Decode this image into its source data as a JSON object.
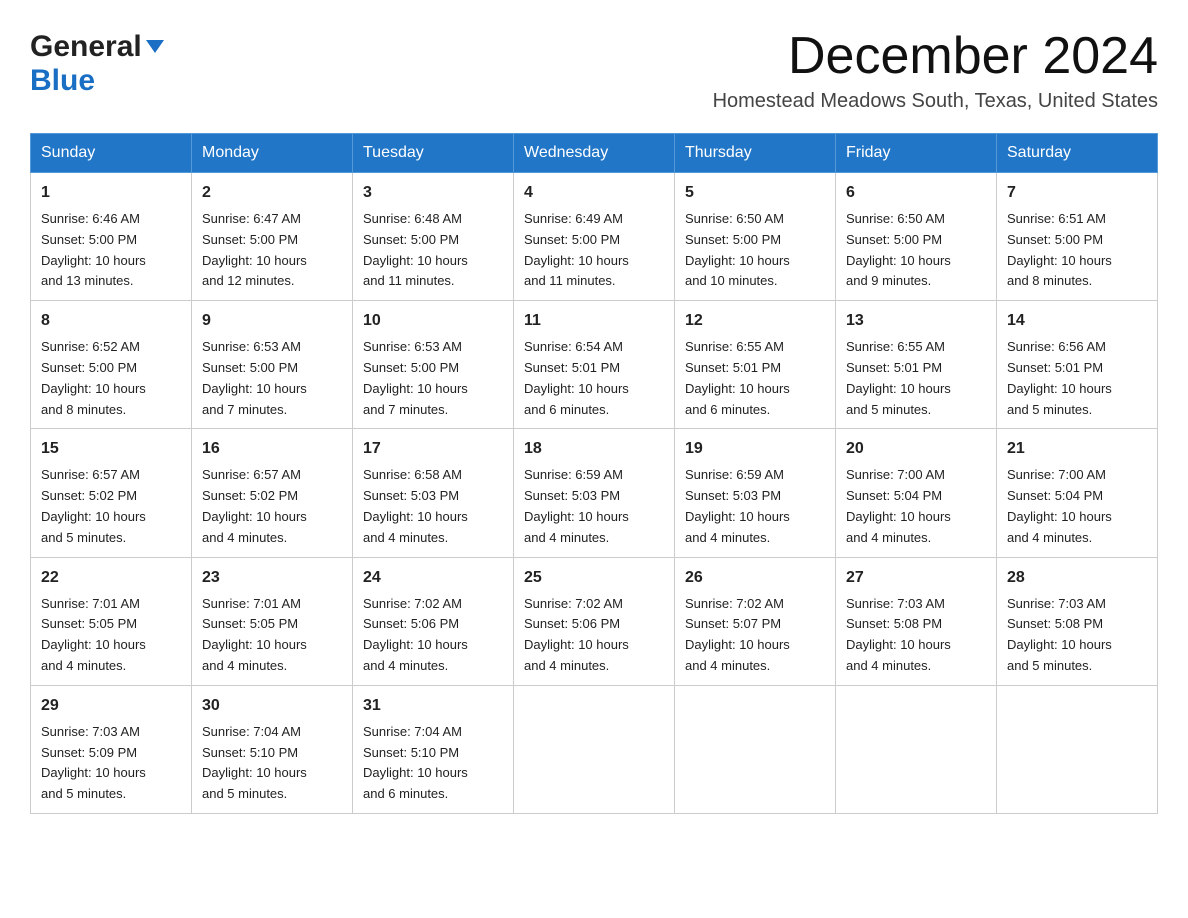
{
  "header": {
    "logo": {
      "general": "General",
      "arrow": "▼",
      "blue": "Blue"
    },
    "title": "December 2024",
    "location": "Homestead Meadows South, Texas, United States"
  },
  "weekdays": [
    "Sunday",
    "Monday",
    "Tuesday",
    "Wednesday",
    "Thursday",
    "Friday",
    "Saturday"
  ],
  "weeks": [
    [
      {
        "day": "1",
        "sunrise": "6:46 AM",
        "sunset": "5:00 PM",
        "daylight": "10 hours and 13 minutes."
      },
      {
        "day": "2",
        "sunrise": "6:47 AM",
        "sunset": "5:00 PM",
        "daylight": "10 hours and 12 minutes."
      },
      {
        "day": "3",
        "sunrise": "6:48 AM",
        "sunset": "5:00 PM",
        "daylight": "10 hours and 11 minutes."
      },
      {
        "day": "4",
        "sunrise": "6:49 AM",
        "sunset": "5:00 PM",
        "daylight": "10 hours and 11 minutes."
      },
      {
        "day": "5",
        "sunrise": "6:50 AM",
        "sunset": "5:00 PM",
        "daylight": "10 hours and 10 minutes."
      },
      {
        "day": "6",
        "sunrise": "6:50 AM",
        "sunset": "5:00 PM",
        "daylight": "10 hours and 9 minutes."
      },
      {
        "day": "7",
        "sunrise": "6:51 AM",
        "sunset": "5:00 PM",
        "daylight": "10 hours and 8 minutes."
      }
    ],
    [
      {
        "day": "8",
        "sunrise": "6:52 AM",
        "sunset": "5:00 PM",
        "daylight": "10 hours and 8 minutes."
      },
      {
        "day": "9",
        "sunrise": "6:53 AM",
        "sunset": "5:00 PM",
        "daylight": "10 hours and 7 minutes."
      },
      {
        "day": "10",
        "sunrise": "6:53 AM",
        "sunset": "5:00 PM",
        "daylight": "10 hours and 7 minutes."
      },
      {
        "day": "11",
        "sunrise": "6:54 AM",
        "sunset": "5:01 PM",
        "daylight": "10 hours and 6 minutes."
      },
      {
        "day": "12",
        "sunrise": "6:55 AM",
        "sunset": "5:01 PM",
        "daylight": "10 hours and 6 minutes."
      },
      {
        "day": "13",
        "sunrise": "6:55 AM",
        "sunset": "5:01 PM",
        "daylight": "10 hours and 5 minutes."
      },
      {
        "day": "14",
        "sunrise": "6:56 AM",
        "sunset": "5:01 PM",
        "daylight": "10 hours and 5 minutes."
      }
    ],
    [
      {
        "day": "15",
        "sunrise": "6:57 AM",
        "sunset": "5:02 PM",
        "daylight": "10 hours and 5 minutes."
      },
      {
        "day": "16",
        "sunrise": "6:57 AM",
        "sunset": "5:02 PM",
        "daylight": "10 hours and 4 minutes."
      },
      {
        "day": "17",
        "sunrise": "6:58 AM",
        "sunset": "5:03 PM",
        "daylight": "10 hours and 4 minutes."
      },
      {
        "day": "18",
        "sunrise": "6:59 AM",
        "sunset": "5:03 PM",
        "daylight": "10 hours and 4 minutes."
      },
      {
        "day": "19",
        "sunrise": "6:59 AM",
        "sunset": "5:03 PM",
        "daylight": "10 hours and 4 minutes."
      },
      {
        "day": "20",
        "sunrise": "7:00 AM",
        "sunset": "5:04 PM",
        "daylight": "10 hours and 4 minutes."
      },
      {
        "day": "21",
        "sunrise": "7:00 AM",
        "sunset": "5:04 PM",
        "daylight": "10 hours and 4 minutes."
      }
    ],
    [
      {
        "day": "22",
        "sunrise": "7:01 AM",
        "sunset": "5:05 PM",
        "daylight": "10 hours and 4 minutes."
      },
      {
        "day": "23",
        "sunrise": "7:01 AM",
        "sunset": "5:05 PM",
        "daylight": "10 hours and 4 minutes."
      },
      {
        "day": "24",
        "sunrise": "7:02 AM",
        "sunset": "5:06 PM",
        "daylight": "10 hours and 4 minutes."
      },
      {
        "day": "25",
        "sunrise": "7:02 AM",
        "sunset": "5:06 PM",
        "daylight": "10 hours and 4 minutes."
      },
      {
        "day": "26",
        "sunrise": "7:02 AM",
        "sunset": "5:07 PM",
        "daylight": "10 hours and 4 minutes."
      },
      {
        "day": "27",
        "sunrise": "7:03 AM",
        "sunset": "5:08 PM",
        "daylight": "10 hours and 4 minutes."
      },
      {
        "day": "28",
        "sunrise": "7:03 AM",
        "sunset": "5:08 PM",
        "daylight": "10 hours and 5 minutes."
      }
    ],
    [
      {
        "day": "29",
        "sunrise": "7:03 AM",
        "sunset": "5:09 PM",
        "daylight": "10 hours and 5 minutes."
      },
      {
        "day": "30",
        "sunrise": "7:04 AM",
        "sunset": "5:10 PM",
        "daylight": "10 hours and 5 minutes."
      },
      {
        "day": "31",
        "sunrise": "7:04 AM",
        "sunset": "5:10 PM",
        "daylight": "10 hours and 6 minutes."
      },
      null,
      null,
      null,
      null
    ]
  ],
  "labels": {
    "sunrise": "Sunrise:",
    "sunset": "Sunset:",
    "daylight": "Daylight:"
  }
}
